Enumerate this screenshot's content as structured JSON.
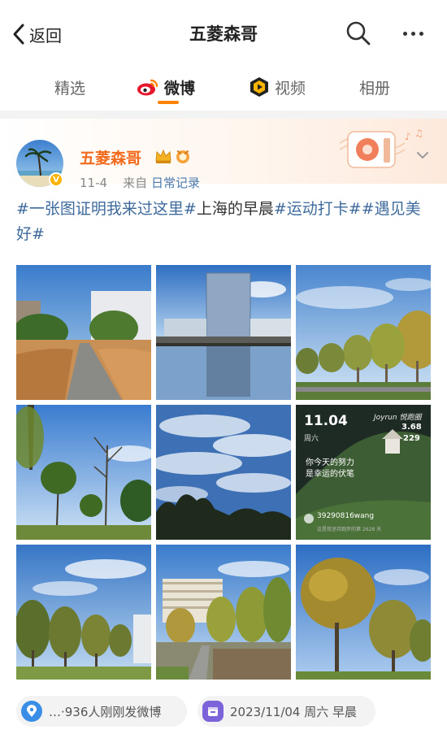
{
  "header": {
    "back_label": "返回",
    "title": "五菱森哥"
  },
  "tabs": [
    {
      "label": "精选"
    },
    {
      "label": "微博"
    },
    {
      "label": "视频"
    },
    {
      "label": "相册"
    }
  ],
  "post": {
    "username": "五菱森哥",
    "date": "11-4",
    "source_prefix": "来自",
    "source": "日常记录",
    "text_parts": [
      {
        "text": "#一张图证明我来过这里#",
        "type": "tag"
      },
      {
        "text": "上海的早晨",
        "type": "plain"
      },
      {
        "text": "#运动打卡#",
        "type": "tag"
      },
      {
        "text": "#遇见美好#",
        "type": "tag"
      }
    ],
    "images": [
      {
        "name": "grass-path-photo"
      },
      {
        "name": "building-reflection-photo"
      },
      {
        "name": "tree-row-photo"
      },
      {
        "name": "park-trees-photo"
      },
      {
        "name": "cloudy-sky-photo"
      },
      {
        "name": "jayrun-app-screenshot"
      },
      {
        "name": "street-trees-photo"
      },
      {
        "name": "office-building-photo"
      },
      {
        "name": "golden-tree-photo"
      }
    ],
    "app_card": {
      "date": "11.04",
      "weekday": "周六",
      "brand": "Joyrun 悦跑圈",
      "stat1": "3.68",
      "stat2": "229",
      "quote_line1": "你今天的努力",
      "quote_line2": "是幸运的伏笔",
      "username": "39290816wang",
      "footer": "这是我坚持跑步的第 2628 天"
    },
    "location_pill": "…·936人刚刚发微博",
    "date_pill": "2023/11/04 周六 早晨"
  },
  "colors": {
    "accent": "#ff8200",
    "username": "#f26a1b",
    "tag": "#3e6a9c"
  }
}
